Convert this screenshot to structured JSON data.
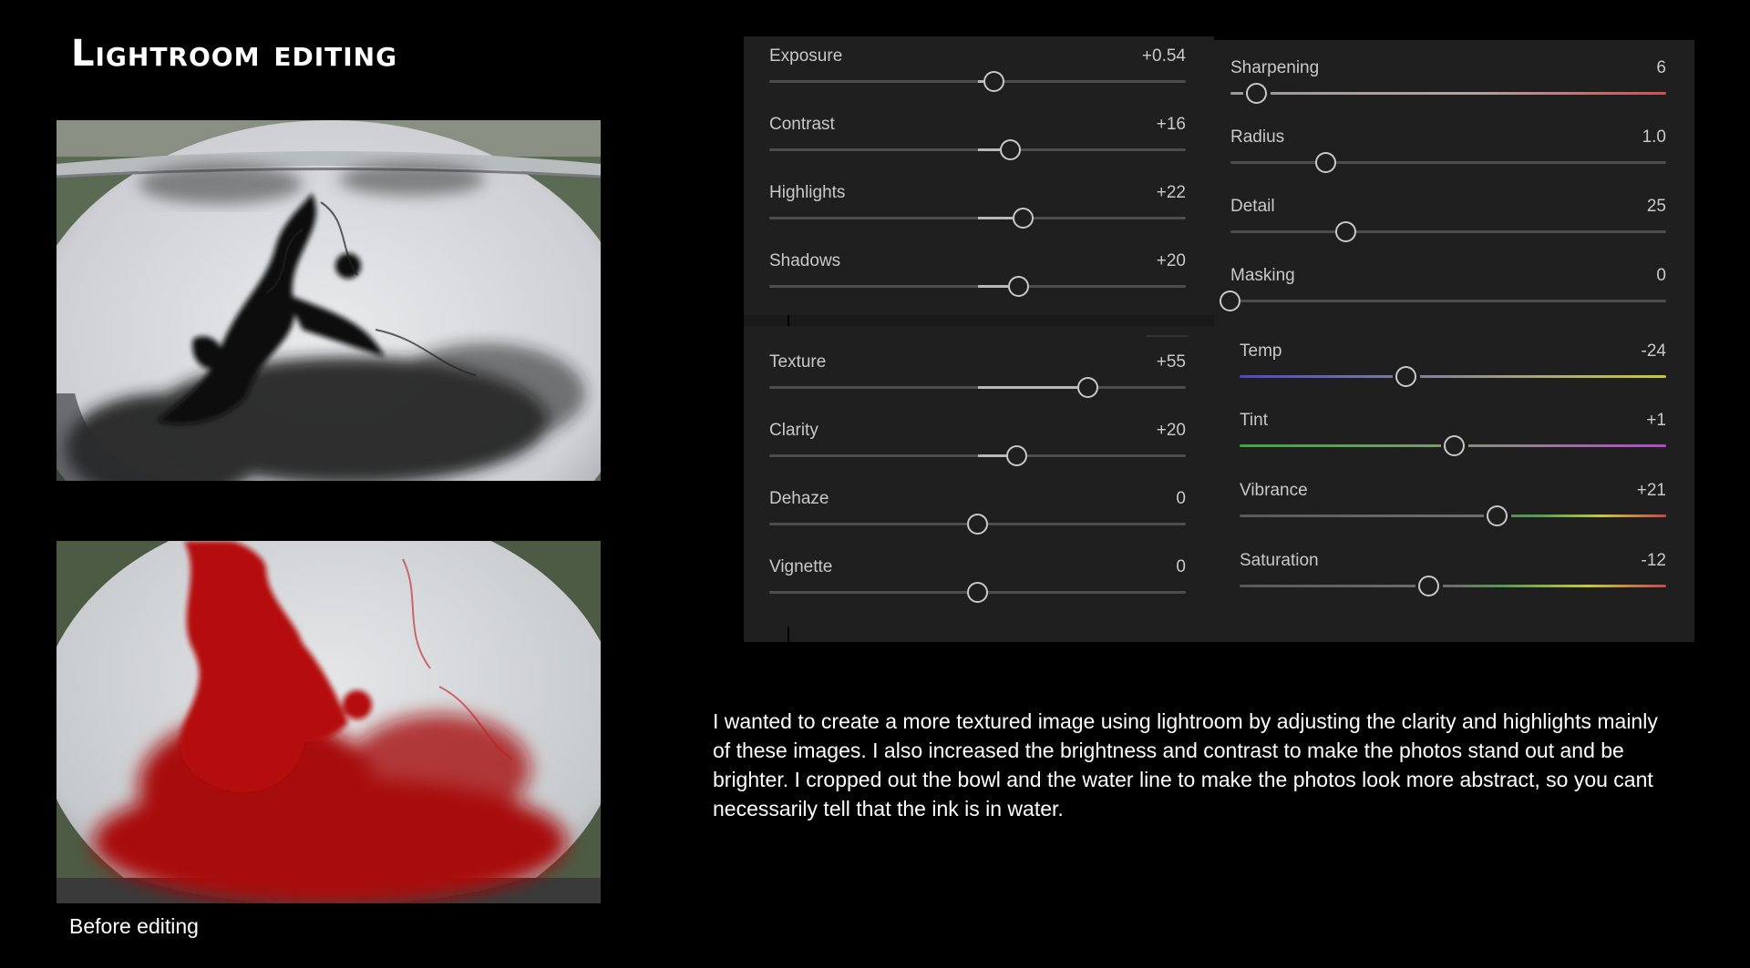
{
  "title": "Lightroom editing",
  "caption": "Before editing",
  "description": "I wanted to create a more textured image using lightroom by adjusting the clarity and highlights mainly of these images. I also increased the brightness and contrast to make the photos stand out and be brighter.  I cropped out the bowl and the water line to make the photos look more abstract, so you cant necessarily  tell that the ink is in water.",
  "basic_panel": {
    "sliders": [
      {
        "label": "Exposure",
        "value": "+0.54",
        "level": 0.54,
        "filled": true
      },
      {
        "label": "Contrast",
        "value": "+16",
        "level": 0.58,
        "filled": true
      },
      {
        "label": "Highlights",
        "value": "+22",
        "level": 0.61,
        "filled": true
      },
      {
        "label": "Shadows",
        "value": "+20",
        "level": 0.6,
        "filled": true
      },
      {
        "label": "Texture",
        "value": "+55",
        "level": 0.765,
        "filled": true
      },
      {
        "label": "Clarity",
        "value": "+20",
        "level": 0.595,
        "filled": true
      },
      {
        "label": "Dehaze",
        "value": "0",
        "level": 0.5,
        "filled": false
      },
      {
        "label": "Vignette",
        "value": "0",
        "level": 0.5,
        "filled": false
      }
    ]
  },
  "detail_panel": {
    "sliders": [
      {
        "label": "Sharpening",
        "value": "6",
        "level": 0.06,
        "track": "sharpen"
      },
      {
        "label": "Radius",
        "value": "1.0",
        "level": 0.22,
        "track": "gray"
      },
      {
        "label": "Detail",
        "value": "25",
        "level": 0.265,
        "track": "gray"
      },
      {
        "label": "Masking",
        "value": "0",
        "level": 0.0,
        "track": "gray"
      },
      {
        "label": "Temp",
        "value": "-24",
        "level": 0.39,
        "track": "temp"
      },
      {
        "label": "Tint",
        "value": "+1",
        "level": 0.505,
        "track": "tint"
      },
      {
        "label": "Vibrance",
        "value": "+21",
        "level": 0.605,
        "track": "vibrance"
      },
      {
        "label": "Saturation",
        "value": "-12",
        "level": 0.445,
        "track": "saturation"
      }
    ]
  },
  "colors": {
    "background": "#000000",
    "panel": "#1f1f1f",
    "label": "#c9c9c9",
    "track": "#4d4d4d",
    "thumb": "#c8c8c8",
    "ink_red": "#b0080c",
    "ink_black": "#141414"
  }
}
